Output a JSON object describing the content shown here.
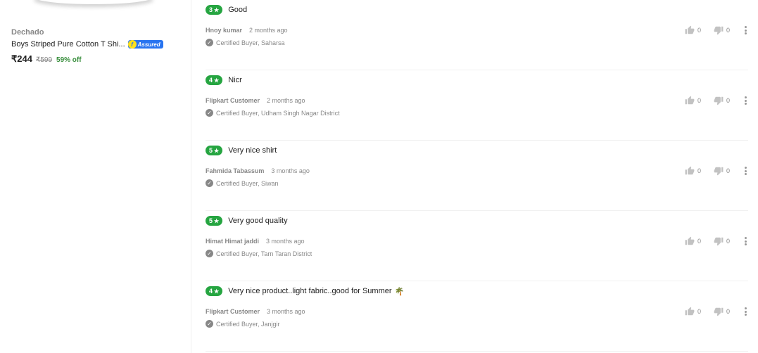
{
  "product": {
    "brand": "Dechado",
    "title": "Boys Striped Pure Cotton T Shi...",
    "assured_label": "Assured",
    "price": "₹244",
    "mrp": "₹599",
    "discount": "59% off"
  },
  "reviews": [
    {
      "rating": "3",
      "title": "Good",
      "emoji": "",
      "author": "Hnoy kumar",
      "date": "2 months ago",
      "certified": "Certified Buyer, Saharsa",
      "likes": "0",
      "dislikes": "0"
    },
    {
      "rating": "4",
      "title": "Nicr",
      "emoji": "",
      "author": "Flipkart Customer",
      "date": "2 months ago",
      "certified": "Certified Buyer, Udham Singh Nagar District",
      "likes": "0",
      "dislikes": "0"
    },
    {
      "rating": "5",
      "title": "Very nice shirt",
      "emoji": "",
      "author": "Fahmida Tabassum",
      "date": "3 months ago",
      "certified": "Certified Buyer, Siwan",
      "likes": "0",
      "dislikes": "0"
    },
    {
      "rating": "5",
      "title": "Very good quality",
      "emoji": "",
      "author": "Himat Himat jaddi",
      "date": "3 months ago",
      "certified": "Certified Buyer, Tarn Taran District",
      "likes": "0",
      "dislikes": "0"
    },
    {
      "rating": "4",
      "title": "Very nice product..light fabric..good for Summer",
      "emoji": "🌴",
      "author": "Flipkart Customer",
      "date": "3 months ago",
      "certified": "Certified Buyer, Janjgir",
      "likes": "0",
      "dislikes": "0"
    }
  ],
  "colors": {
    "rating_badge": "#26a541",
    "discount": "#388e3c",
    "assured": "#2874f0"
  }
}
